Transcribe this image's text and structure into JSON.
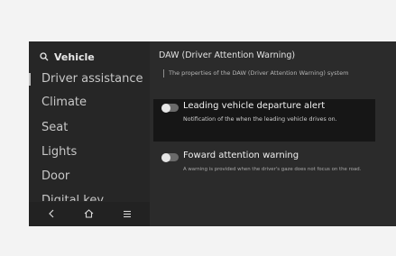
{
  "sidebar": {
    "title": "Vehicle",
    "items": [
      {
        "label": "Driver assistance"
      },
      {
        "label": "Climate"
      },
      {
        "label": "Seat"
      },
      {
        "label": "Lights"
      },
      {
        "label": "Door"
      },
      {
        "label": "Digital key"
      }
    ],
    "bottom_icons": [
      "back-icon",
      "home-icon",
      "menu-icon"
    ]
  },
  "main": {
    "title": "DAW (Driver Attention Warning)",
    "description": "The properties of the DAW (Driver Attention Warning) system",
    "settings": [
      {
        "title": "Leading vehicle departure alert",
        "description": "Notification of the when the leading vehicle drives on.",
        "enabled": false
      },
      {
        "title": "Foward attention warning",
        "description": "A warning is provided when the driver's gaze does not focus on the road.",
        "enabled": false
      }
    ]
  },
  "colors": {
    "background": "#2b2b2b",
    "highlight_row": "#161616",
    "text_primary": "#f0f0f0",
    "text_secondary": "#b4b4b4"
  }
}
